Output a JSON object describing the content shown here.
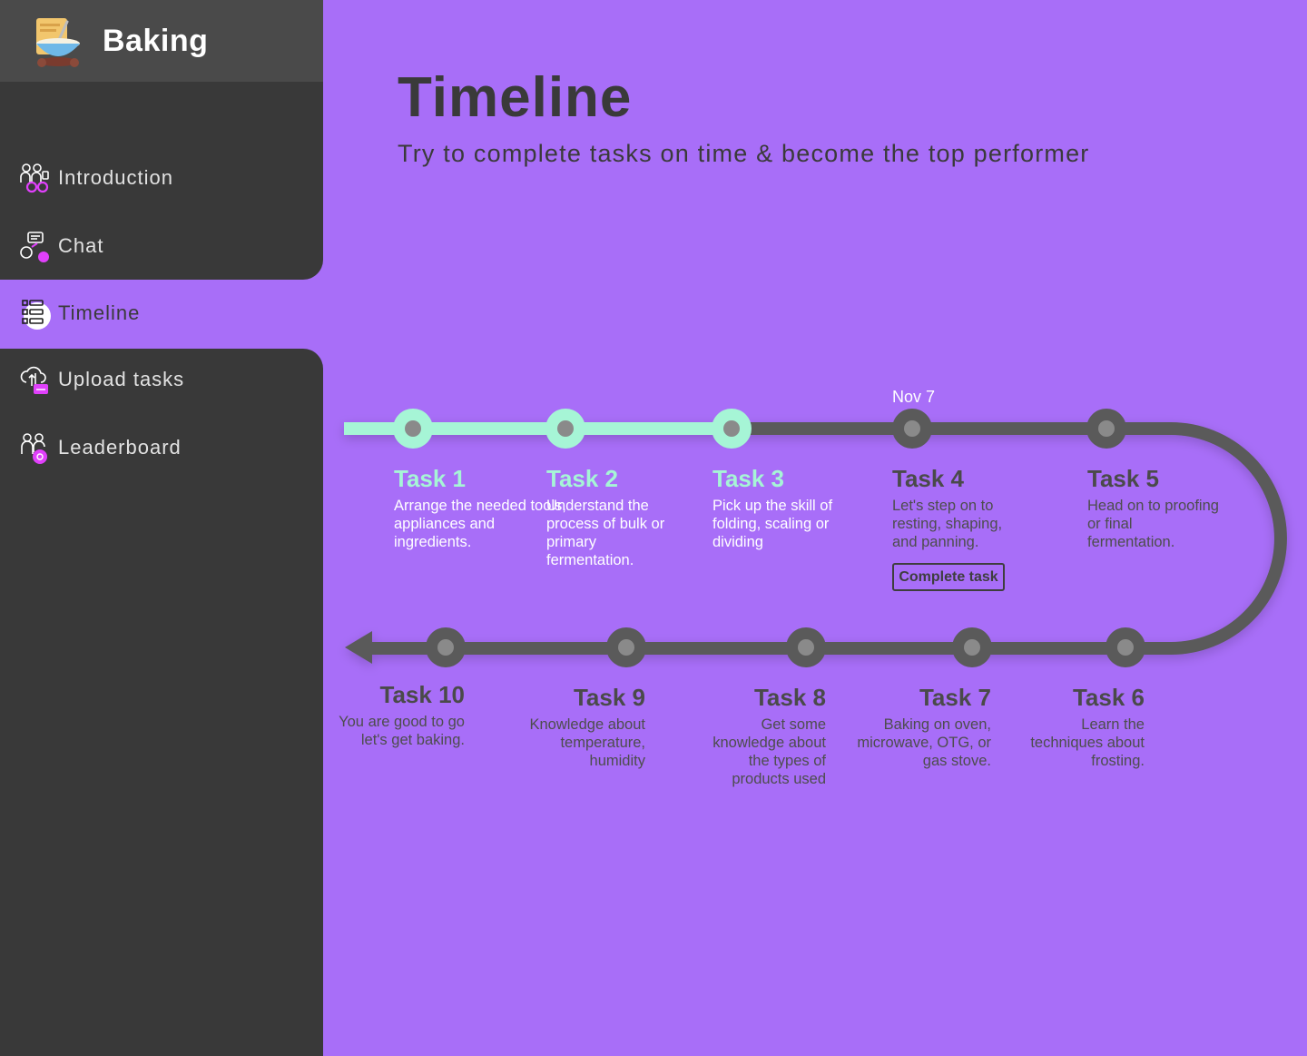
{
  "brand": {
    "name": "Baking",
    "logo_icon": "baking-bowl-logo"
  },
  "nav": {
    "items": [
      {
        "label": "Introduction",
        "icon": "people-icon",
        "active": false
      },
      {
        "label": "Chat",
        "icon": "chat-icon",
        "active": false
      },
      {
        "label": "Timeline",
        "icon": "list-timeline-icon",
        "active": true
      },
      {
        "label": "Upload tasks",
        "icon": "cloud-upload-icon",
        "active": false
      },
      {
        "label": "Leaderboard",
        "icon": "leaderboard-people-icon",
        "active": false
      }
    ]
  },
  "main": {
    "title": "Timeline",
    "subtitle": "Try to complete tasks on time & become the top performer"
  },
  "timeline": {
    "current_date": "Nov 7",
    "complete_button": "Complete task",
    "tasks": [
      {
        "title": "Task 1",
        "desc": "Arrange the needed tools, appliances and ingredients.",
        "done": true
      },
      {
        "title": "Task 2",
        "desc": "Understand the process of bulk or primary fermentation.",
        "done": true
      },
      {
        "title": "Task 3",
        "desc": "Pick up the skill of folding, scaling or dividing",
        "done": true
      },
      {
        "title": "Task 4",
        "desc": "Let's step on to resting, shaping, and panning.",
        "done": false
      },
      {
        "title": "Task 5",
        "desc": "Head on to proofing or final fermentation.",
        "done": false
      },
      {
        "title": "Task 6",
        "desc": "Learn the techniques about frosting.",
        "done": false
      },
      {
        "title": "Task 7",
        "desc": "Baking on oven, microwave, OTG, or gas stove.",
        "done": false
      },
      {
        "title": "Task 8",
        "desc": "Get some knowledge about the types of products used",
        "done": false
      },
      {
        "title": "Task 9",
        "desc": "Knowledge about temperature, humidity",
        "done": false
      },
      {
        "title": "Task 10",
        "desc": "You are good to go let's get baking.",
        "done": false
      }
    ],
    "colors": {
      "done": "#a6f5d6",
      "pending": "#5a5a5a",
      "node_center": "#8a8a8a",
      "background": "#a86ef8"
    }
  }
}
